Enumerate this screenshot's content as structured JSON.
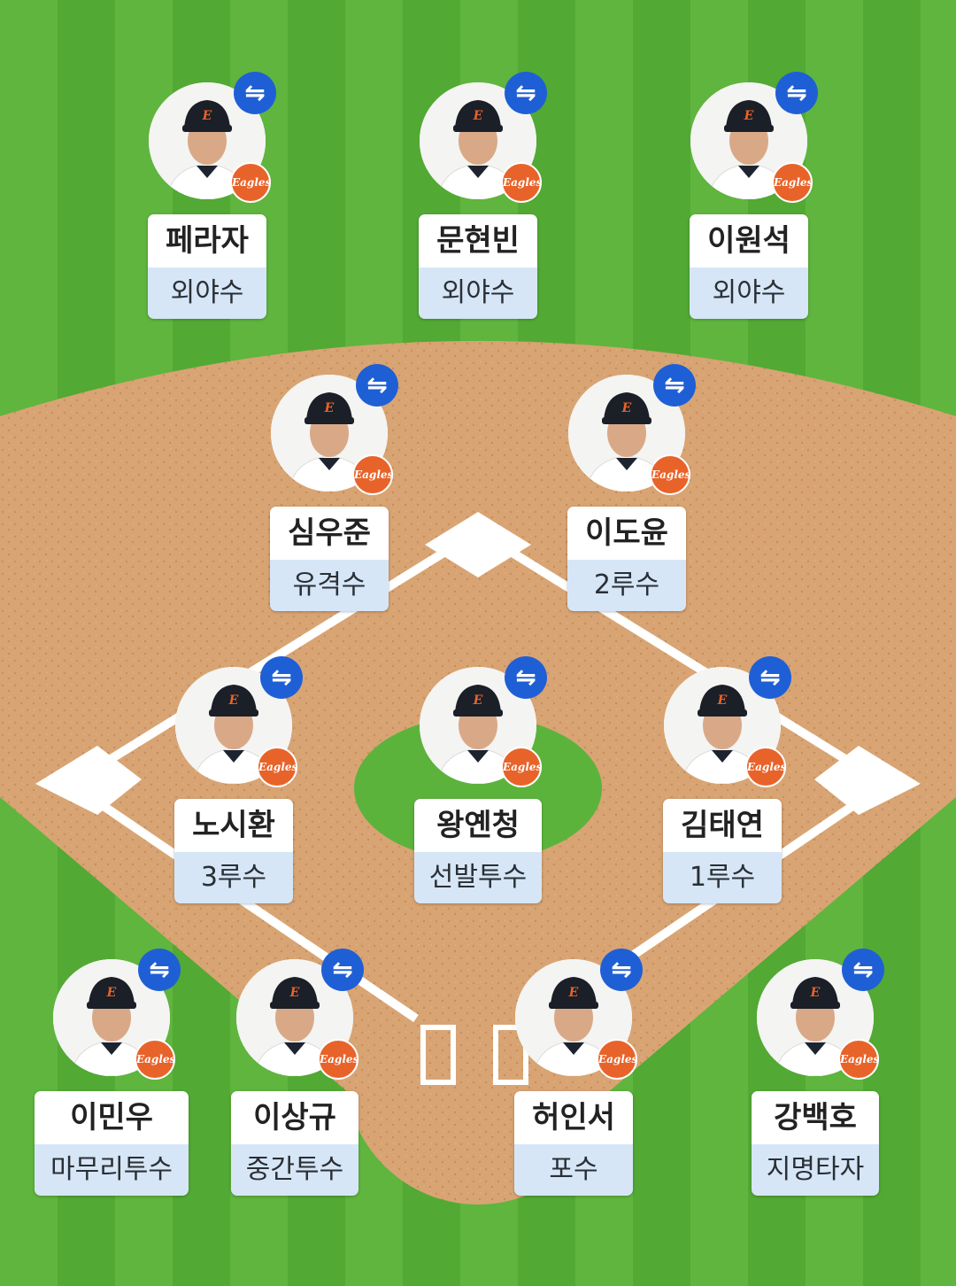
{
  "colors": {
    "grass_light": "#5cb33c",
    "grass_dark": "#4ea532",
    "dirt": "#d9a574",
    "line": "#ffffff",
    "swap_button": "#1f5fd6",
    "logo": "#e8632a",
    "position_bg": "#d6e6f6"
  },
  "players": [
    {
      "name": "페라자",
      "position": "외야수",
      "logo": "Eagles",
      "swap_icon": "⇋"
    },
    {
      "name": "문현빈",
      "position": "외야수",
      "logo": "Eagles",
      "swap_icon": "⇋"
    },
    {
      "name": "이원석",
      "position": "외야수",
      "logo": "Eagles",
      "swap_icon": "⇋"
    },
    {
      "name": "심우준",
      "position": "유격수",
      "logo": "Eagles",
      "swap_icon": "⇋"
    },
    {
      "name": "이도윤",
      "position": "2루수",
      "logo": "Eagles",
      "swap_icon": "⇋"
    },
    {
      "name": "노시환",
      "position": "3루수",
      "logo": "Eagles",
      "swap_icon": "⇋"
    },
    {
      "name": "왕옌청",
      "position": "선발투수",
      "logo": "Eagles",
      "swap_icon": "⇋"
    },
    {
      "name": "김태연",
      "position": "1루수",
      "logo": "Eagles",
      "swap_icon": "⇋"
    },
    {
      "name": "이민우",
      "position": "마무리투수",
      "logo": "Eagles",
      "swap_icon": "⇋"
    },
    {
      "name": "이상규",
      "position": "중간투수",
      "logo": "Eagles",
      "swap_icon": "⇋"
    },
    {
      "name": "허인서",
      "position": "포수",
      "logo": "Eagles",
      "swap_icon": "⇋"
    },
    {
      "name": "강백호",
      "position": "지명타자",
      "logo": "Eagles",
      "swap_icon": "⇋"
    }
  ]
}
